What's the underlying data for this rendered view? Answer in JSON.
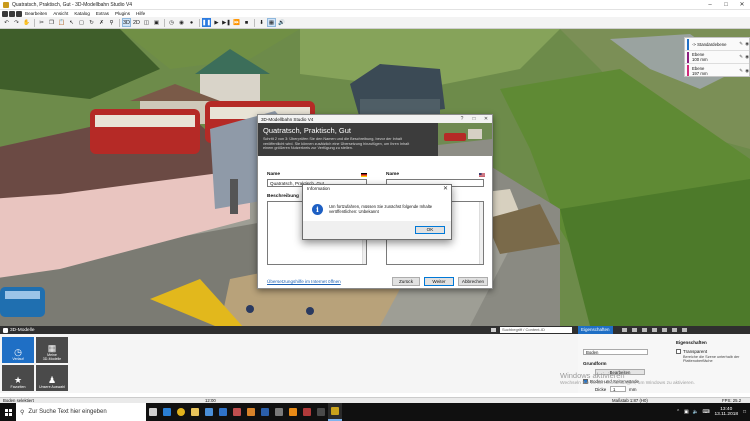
{
  "window": {
    "title": "Quatratsch, Praktisch, Gut - 3D-Modellbahn Studio V4"
  },
  "menu": [
    "Bearbeiten",
    "Ansicht",
    "Katalog",
    "Extras",
    "Plugins",
    "Hilfe"
  ],
  "toolbar": {
    "icons": [
      "undo-icon",
      "redo-icon",
      "hand-icon",
      "cut-icon",
      "copy-icon",
      "paste-icon",
      "select-icon",
      "box-select-icon",
      "rotate-icon",
      "delete-icon",
      "zoom-icon"
    ],
    "view_3d": "3D",
    "view_2d": "2D",
    "right_icons": [
      "clock-icon",
      "camera-icon",
      "record-icon",
      "pause-icon",
      "play-icon",
      "step-icon",
      "fast-forward-icon",
      "stop-icon",
      "download-icon",
      "grid-icon",
      "sound-icon"
    ]
  },
  "layers": [
    {
      "name": "-> Standardebene",
      "color": "#1f6fc5"
    },
    {
      "name": "Ebene\n100 mm",
      "color": "#8b1e7f"
    },
    {
      "name": "Ebene\n197 mm",
      "color": "#d02a7a"
    }
  ],
  "dialog": {
    "window_title": "3D-Modellbahn Studio V4",
    "heading": "Quatratsch, Praktisch, Gut",
    "description": "Schritt 2 von 3: Überprüfen Sie den Namen und die Beschreibung, bevor der Inhalt veröffentlicht wird. Sie können zusätzlich eine Übersetzung hinzufügen, um Ihren Inhalt einem größeren Nutzerkreis zur Verfügung zu stellen.",
    "name_label": "Name",
    "name_value": "Quatratsch, Praktisch, Gut",
    "name_label_right": "Name",
    "desc_label": "Beschreibung",
    "translate_link": "Übersetzungshilfe im Internet öffnen",
    "back_button": "Zurück",
    "next_button": "Weiter",
    "cancel_button": "Abbrechen"
  },
  "modal": {
    "title": "Information",
    "message": "Um fortzufahren, müssen Sie zunächst folgende Inhalte veröffentlichen: Unbekannt",
    "ok_button": "OK"
  },
  "dock": {
    "title": "3D-Modelle",
    "search_placeholder": "Suchbegriff / Content-ID",
    "props_tab": "Eigenschaften"
  },
  "catalog_tiles": [
    {
      "label": "Verlauf",
      "icon": "clock-icon",
      "selected": true
    },
    {
      "label": "Meine\n3D-Modelle",
      "icon": "grid-icon",
      "selected": false
    },
    {
      "label": "Favoriten",
      "icon": "star-icon",
      "selected": false
    },
    {
      "label": "Unsere Auswahl",
      "icon": "people-icon",
      "selected": false
    }
  ],
  "properties": {
    "name_value": "Boden",
    "grundform_label": "Grundform",
    "edit_button": "Bearbeiten",
    "sides_label": "Boden und Seitenwände",
    "thickness_label": "Dicke",
    "thickness_value": "1",
    "thickness_unit": "mm",
    "appearance_heading": "Eigenschaften",
    "transparent_label": "Transparent",
    "transparent_hint": "Bereiche die Szene unterhalb der Plattenoberfläche"
  },
  "watermark": {
    "title": "Windows aktivieren",
    "subtitle": "Wechseln Sie zu den Einstellungen, um Windows zu aktivieren."
  },
  "statusbar": {
    "left": "Boden selektiert",
    "time": "12:00",
    "scale": "Maßstab 1:87 (H0)",
    "fps": "FPS: 25.2"
  },
  "taskbar": {
    "search_placeholder": "Zur Suche Text hier eingeben",
    "time": "13:40",
    "date": "13.11.2018",
    "apps": [
      {
        "icon": "task-view-icon",
        "color": "#cfcfcf"
      },
      {
        "icon": "edge-icon",
        "color": "#2a7fd4"
      },
      {
        "icon": "chrome-icon",
        "color": "#e0b21c"
      },
      {
        "icon": "explorer-icon",
        "color": "#e8c45b"
      },
      {
        "icon": "store-icon",
        "color": "#4a8fd8"
      },
      {
        "icon": "mail-icon",
        "color": "#2f73c9"
      },
      {
        "icon": "photo-icon",
        "color": "#c04e4e"
      },
      {
        "icon": "media-icon",
        "color": "#d8832a"
      },
      {
        "icon": "word-icon",
        "color": "#2b5faa"
      },
      {
        "icon": "app-icon",
        "color": "#7a7a7a"
      },
      {
        "icon": "vlc-icon",
        "color": "#e88a16"
      },
      {
        "icon": "app2-icon",
        "color": "#b03a3a"
      },
      {
        "icon": "app3-icon",
        "color": "#4a4a4a"
      },
      {
        "icon": "modellbahn-icon",
        "color": "#c9a21c"
      }
    ]
  }
}
